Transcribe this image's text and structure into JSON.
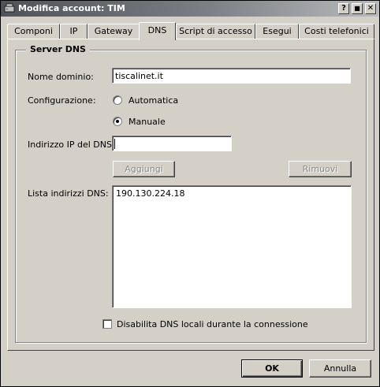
{
  "window": {
    "title": "Modifica account: TIM"
  },
  "titlebar_buttons": {
    "help": "?",
    "maximize": "■",
    "close": "✕"
  },
  "tabs": [
    {
      "label": "Componi",
      "active": false
    },
    {
      "label": "IP",
      "active": false
    },
    {
      "label": "Gateway",
      "active": false
    },
    {
      "label": "DNS",
      "active": true
    },
    {
      "label": "Script di accesso",
      "active": false
    },
    {
      "label": "Esegui",
      "active": false
    },
    {
      "label": "Costi telefonici",
      "active": false
    }
  ],
  "dns_group": {
    "title": "Server DNS",
    "domain_label": "Nome dominio:",
    "domain_value": "tiscalinet.it",
    "config_label": "Configurazione:",
    "radio_auto": "Automatica",
    "radio_manual": "Manuale",
    "selected_config": "Manuale",
    "ip_label": "Indirizzo IP del DNS:",
    "ip_value": "",
    "add_button": "Aggiungi",
    "remove_button": "Rimuovi",
    "list_label": "Lista indirizzi DNS:",
    "list_items": [
      "190.130.224.18"
    ],
    "disable_local_label": "Disabilita DNS locali durante la connessione",
    "disable_local_checked": false
  },
  "footer": {
    "ok": "OK",
    "cancel": "Annulla"
  }
}
